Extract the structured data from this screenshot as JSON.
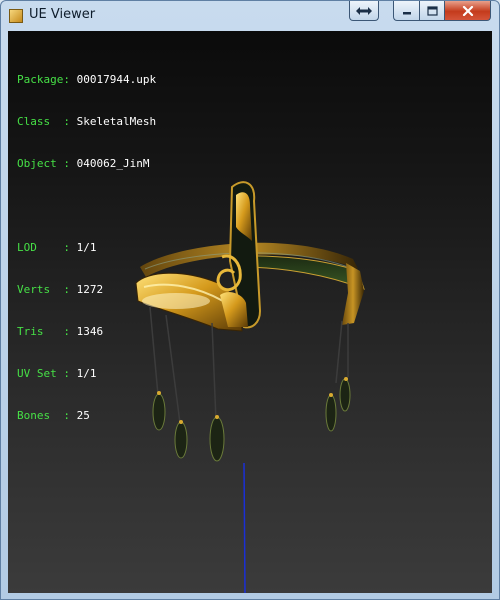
{
  "window": {
    "title": "UE Viewer"
  },
  "titlebar_buttons": {
    "swap_icon": "double-arrow-icon",
    "min_icon": "minimize-icon",
    "max_icon": "maximize-icon",
    "close_icon": "close-icon"
  },
  "info": {
    "package_key": "Package:",
    "package_val": "00017944.upk",
    "class_key": "Class  :",
    "class_val": "SkeletalMesh",
    "object_key": "Object :",
    "object_val": "040062_JinM",
    "lod_key": "LOD    :",
    "lod_val": "1/1",
    "verts_key": "Verts  :",
    "verts_val": "1272",
    "tris_key": "Tris   :",
    "tris_val": "1346",
    "uvset_key": "UV Set :",
    "uvset_val": "1/1",
    "bones_key": "Bones  :",
    "bones_val": "25"
  },
  "colors": {
    "label": "#46e046",
    "value": "#ffffff",
    "axis": "#1a2fd6",
    "gold": "#e0b030"
  }
}
